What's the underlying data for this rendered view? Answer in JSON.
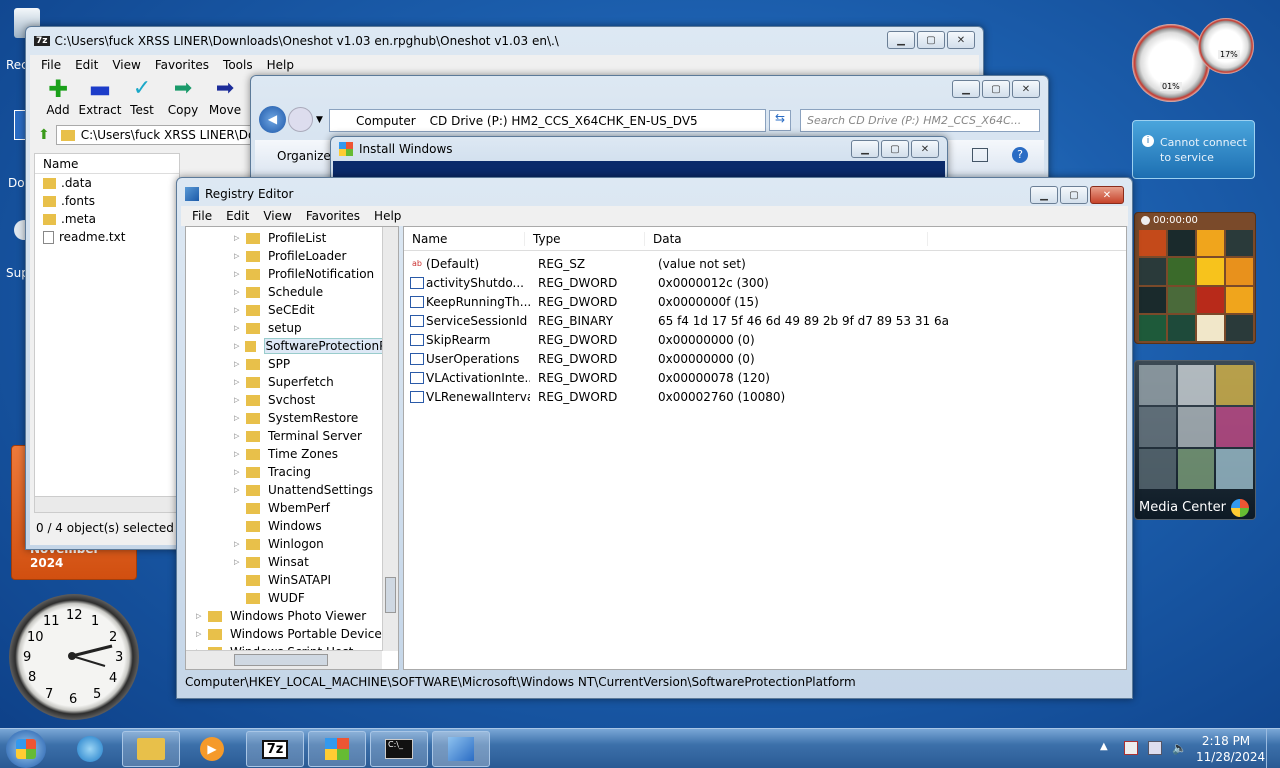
{
  "desktop": {
    "icons": [
      "Rec",
      "Do",
      "Sup"
    ]
  },
  "window_7z": {
    "title": "C:\\Users\\fuck XRSS LINER\\Downloads\\Oneshot v1.03 en.rpghub\\Oneshot v1.03 en\\.\\",
    "app_icon": "7z",
    "menu": [
      "File",
      "Edit",
      "View",
      "Favorites",
      "Tools",
      "Help"
    ],
    "toolbar": [
      "Add",
      "Extract",
      "Test",
      "Copy",
      "Move"
    ],
    "address": "C:\\Users\\fuck XRSS LINER\\Dow",
    "column": "Name",
    "files": [
      ".data",
      ".fonts",
      ".meta",
      "readme.txt"
    ],
    "status": "0 / 4 object(s) selected"
  },
  "window_explorer": {
    "crumbs": [
      "Computer",
      "CD Drive (P:) HM2_CCS_X64CHK_EN-US_DV5"
    ],
    "search_placeholder": "Search CD Drive (P:) HM2_CCS_X64C...",
    "organize": "Organize"
  },
  "window_install": {
    "title": "Install Windows"
  },
  "regedit": {
    "title": "Registry Editor",
    "menu": [
      "File",
      "Edit",
      "View",
      "Favorites",
      "Help"
    ],
    "tree": [
      "ProfileList",
      "ProfileLoader",
      "ProfileNotification",
      "Schedule",
      "SeCEdit",
      "setup",
      "SoftwareProtectionPla",
      "SPP",
      "Superfetch",
      "Svchost",
      "SystemRestore",
      "Terminal Server",
      "Time Zones",
      "Tracing",
      "UnattendSettings",
      "WbemPerf",
      "Windows",
      "Winlogon",
      "Winsat",
      "WinSATAPI",
      "WUDF"
    ],
    "tree_parent": [
      "Windows Photo Viewer",
      "Windows Portable Devices",
      "Windows Script Host"
    ],
    "columns": [
      "Name",
      "Type",
      "Data"
    ],
    "values": [
      {
        "name": "(Default)",
        "type": "REG_SZ",
        "data": "(value not set)"
      },
      {
        "name": "activityShutdo...",
        "type": "REG_DWORD",
        "data": "0x0000012c (300)"
      },
      {
        "name": "KeepRunningTh...",
        "type": "REG_DWORD",
        "data": "0x0000000f (15)"
      },
      {
        "name": "ServiceSessionId",
        "type": "REG_BINARY",
        "data": "65 f4 1d 17 5f 46 6d 49 89 2b 9f d7 89 53 31 6a"
      },
      {
        "name": "SkipRearm",
        "type": "REG_DWORD",
        "data": "0x00000000 (0)"
      },
      {
        "name": "UserOperations",
        "type": "REG_DWORD",
        "data": "0x00000000 (0)"
      },
      {
        "name": "VLActivationInte...",
        "type": "REG_DWORD",
        "data": "0x00000078 (120)"
      },
      {
        "name": "VLRenewalInterval",
        "type": "REG_DWORD",
        "data": "0x00002760 (10080)"
      }
    ],
    "status": "Computer\\HKEY_LOCAL_MACHINE\\SOFTWARE\\Microsoft\\Windows NT\\CurrentVersion\\SoftwareProtectionPlatform"
  },
  "gadgets": {
    "cpu": "01%",
    "mem": "17%",
    "weather": "Cannot connect to service",
    "puzzle_timer": "00:00:00",
    "media_center": "Media Center",
    "calendar": "November 2024",
    "clock_numbers": [
      "12",
      "1",
      "2",
      "3",
      "4",
      "5",
      "6",
      "7",
      "8",
      "9",
      "10",
      "11"
    ]
  },
  "taskbar": {
    "time": "2:18 PM",
    "date": "11/28/2024",
    "sevenzip": "7z"
  }
}
